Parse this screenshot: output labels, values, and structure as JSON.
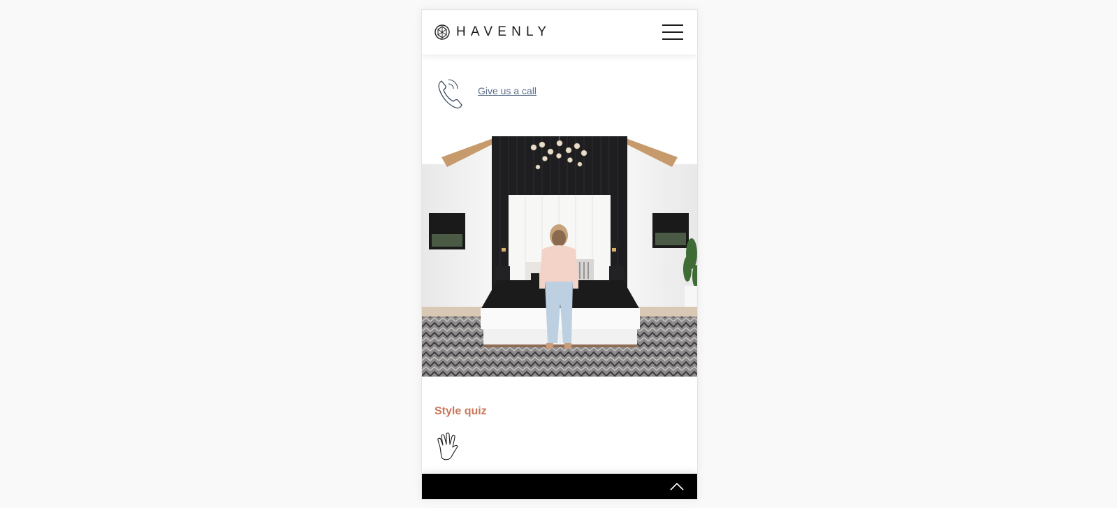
{
  "header": {
    "logo_text": "HAVENLY",
    "logo_icon": "havenly-geo-logo-icon",
    "menu_icon": "hamburger-icon"
  },
  "contact": {
    "icon": "phone-icon",
    "call_label": "Give us a call"
  },
  "hero": {
    "description": "bedroom-photo"
  },
  "quiz": {
    "title": "Style quiz",
    "icon": "waving-hand-icon"
  },
  "footer_bar": {
    "icon": "chevron-up-icon"
  },
  "colors": {
    "accent": "#c8775a",
    "link": "#5b6e88",
    "text": "#1c1c1c",
    "bar": "#000000"
  }
}
